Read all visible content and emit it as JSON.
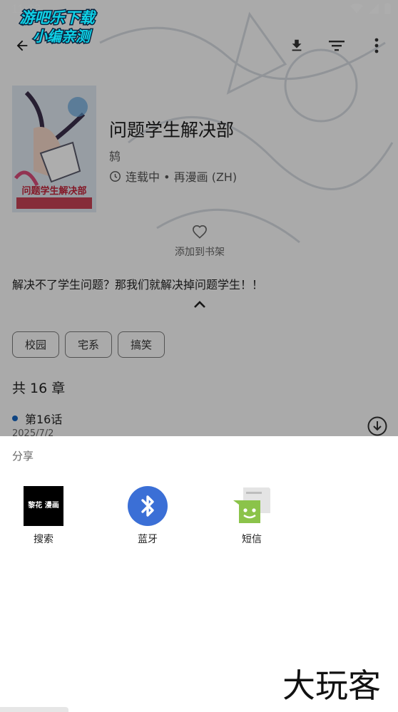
{
  "status_bar": {
    "time": "11:23"
  },
  "watermark_top": {
    "line1": "游吧乐下载",
    "line2": "小编亲测"
  },
  "top_bar": {
    "icons": [
      "back-arrow-icon",
      "download-icon",
      "filter-icon",
      "more-vert-icon"
    ]
  },
  "manga": {
    "title": "问题学生解决部",
    "author": "鸫",
    "status": "连载中 • 再漫画 (ZH)",
    "cover_text": "问题学生解决部",
    "favorite_label": "添加到书架",
    "description": "解决不了学生问题？那我们就解决掉问题学生！！",
    "tags": [
      "校园",
      "宅系",
      "搞笑"
    ]
  },
  "chapters": {
    "count_label": "共 16 章",
    "items": [
      {
        "name": "第16话",
        "date": "2025/7/2"
      }
    ]
  },
  "share_sheet": {
    "title": "分享",
    "targets": [
      {
        "label": "搜索",
        "icon": "app-logo-icon",
        "logo_text": "黎花 漫画"
      },
      {
        "label": "蓝牙",
        "icon": "bluetooth-icon"
      },
      {
        "label": "短信",
        "icon": "messaging-icon"
      }
    ]
  },
  "watermark_bottom": {
    "text": "大玩客"
  },
  "colors": {
    "accent": "#1565c0",
    "bluetooth": "#3b6fd6",
    "messaging": "#8bc34a",
    "watermark_cyan": "#0fd1e6",
    "scrim": "rgba(0,0,0,0.32)"
  }
}
